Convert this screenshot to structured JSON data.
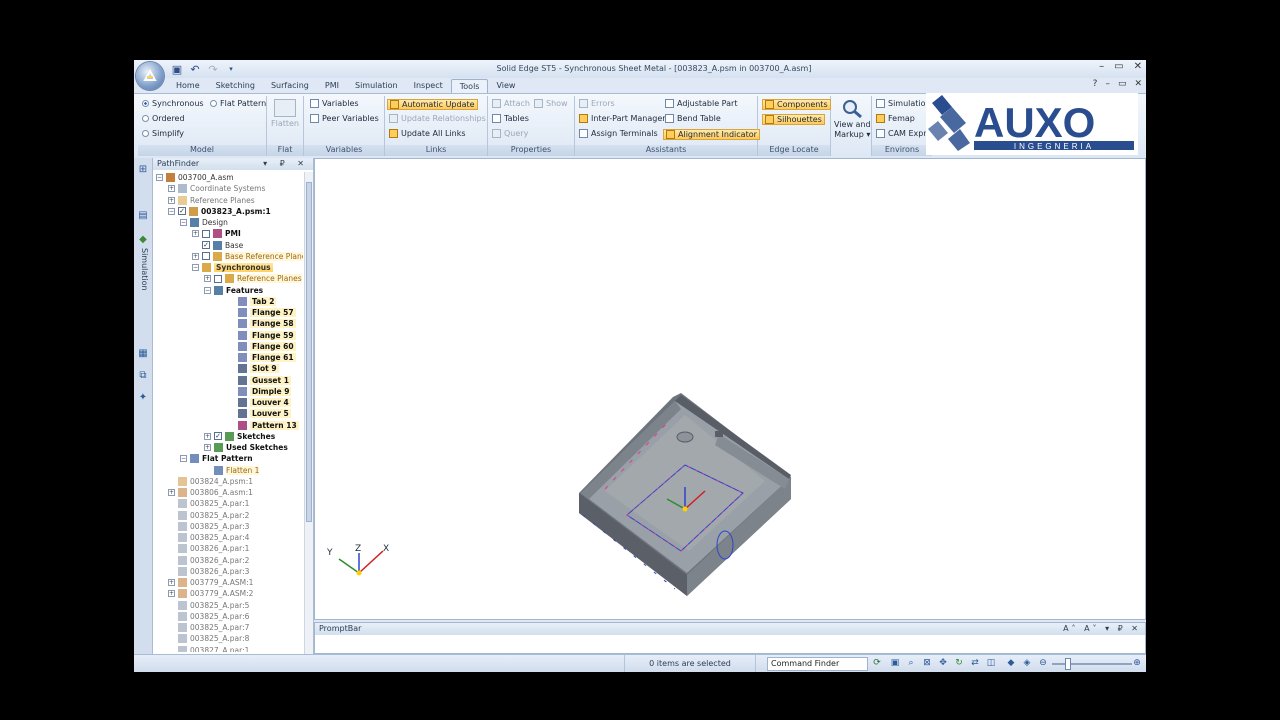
{
  "window": {
    "title": "Solid Edge ST5 - Synchronous Sheet Metal - [003823_A.psm in 003700_A.asm]",
    "controls": [
      "–",
      "▭",
      "✕"
    ],
    "sub_controls": [
      "?",
      "–",
      "▭",
      "✕"
    ]
  },
  "ribbon_tabs": [
    {
      "label": "Home"
    },
    {
      "label": "Sketching"
    },
    {
      "label": "Surfacing"
    },
    {
      "label": "PMI"
    },
    {
      "label": "Simulation"
    },
    {
      "label": "Inspect"
    },
    {
      "label": "Tools",
      "active": true
    },
    {
      "label": "View"
    }
  ],
  "groups": {
    "model": {
      "label": "Model",
      "synchronous": "Synchronous",
      "flat_pattern": "Flat Pattern",
      "ordered": "Ordered",
      "simplify": "Simplify"
    },
    "flat": {
      "label": "Flat",
      "flatten": "Flatten"
    },
    "variables": {
      "label": "Variables",
      "variables": "Variables",
      "peer_variables": "Peer Variables"
    },
    "links": {
      "label": "Links",
      "automatic_update": "Automatic Update",
      "update_relationships": "Update Relationships",
      "update_all_links": "Update All Links"
    },
    "properties": {
      "label": "Properties",
      "attach": "Attach",
      "show": "Show",
      "tables": "Tables",
      "query": "Query"
    },
    "assistants": {
      "label": "Assistants",
      "errors": "Errors",
      "adjustable_part": "Adjustable Part",
      "inter_part_manager": "Inter-Part Manager",
      "bend_table": "Bend Table",
      "assign_terminals": "Assign Terminals",
      "alignment_indicator": "Alignment Indicator"
    },
    "edge_locate": {
      "label": "Edge Locate",
      "components": "Components",
      "silhouettes": "Silhouettes"
    },
    "view_markup": {
      "line1": "View and",
      "line2": "Markup ▾"
    },
    "environs": {
      "label": "Environs",
      "simulation": "Simulatio",
      "femap": "Femap",
      "cam_express": "CAM Expr"
    }
  },
  "logo": {
    "name": "AUXO",
    "sub": "INGEGNERIA",
    "color": "#2a4d8f"
  },
  "left_strip": {
    "simulation": "Simulation"
  },
  "pathfinder": {
    "title": "PathFinder",
    "controls": "▾ ₽ ✕",
    "tree": [
      {
        "label": "003700_A.asm",
        "indent": 0,
        "exp": "−",
        "style": "",
        "icon": "asm"
      },
      {
        "label": "Coordinate Systems",
        "indent": 1,
        "exp": "+",
        "style": "gray",
        "icon": "cs"
      },
      {
        "label": "Reference Planes",
        "indent": 1,
        "exp": "+",
        "style": "gray",
        "icon": "rp"
      },
      {
        "label": "003823_A.psm:1",
        "indent": 1,
        "exp": "−",
        "style": "bold",
        "icon": "psm",
        "check": "✓"
      },
      {
        "label": "Design",
        "indent": 2,
        "exp": "−",
        "style": "",
        "icon": "design"
      },
      {
        "label": "PMI",
        "indent": 3,
        "exp": "+",
        "style": "bold",
        "icon": "pmi",
        "check": " "
      },
      {
        "label": "Base",
        "indent": 3,
        "exp": "",
        "style": "",
        "icon": "base",
        "check": "✓"
      },
      {
        "label": "Base Reference Planes",
        "indent": 3,
        "exp": "+",
        "style": "ora",
        "icon": "rp",
        "check": " "
      },
      {
        "label": "Synchronous",
        "indent": 3,
        "exp": "−",
        "style": "sel",
        "icon": "sync"
      },
      {
        "label": "Reference Planes",
        "indent": 4,
        "exp": "+",
        "style": "ora",
        "icon": "rp",
        "check": " "
      },
      {
        "label": "Features",
        "indent": 4,
        "exp": "−",
        "style": "bold",
        "icon": "feat"
      },
      {
        "label": "Tab 2",
        "indent": 6,
        "exp": "",
        "style": "hlrow bold",
        "icon": "tab"
      },
      {
        "label": "Flange 57",
        "indent": 6,
        "exp": "",
        "style": "hlrow bold",
        "icon": "flange"
      },
      {
        "label": "Flange 58",
        "indent": 6,
        "exp": "",
        "style": "hlrow bold",
        "icon": "flange"
      },
      {
        "label": "Flange 59",
        "indent": 6,
        "exp": "",
        "style": "hlrow bold",
        "icon": "flange"
      },
      {
        "label": "Flange 60",
        "indent": 6,
        "exp": "",
        "style": "hlrow bold",
        "icon": "flange"
      },
      {
        "label": "Flange 61",
        "indent": 6,
        "exp": "",
        "style": "hlrow bold",
        "icon": "flange"
      },
      {
        "label": "Slot 9",
        "indent": 6,
        "exp": "",
        "style": "hlrow bold",
        "icon": "slot"
      },
      {
        "label": "Gusset 1",
        "indent": 6,
        "exp": "",
        "style": "hlrow bold",
        "icon": "gusset"
      },
      {
        "label": "Dimple 9",
        "indent": 6,
        "exp": "",
        "style": "hlrow bold",
        "icon": "dimple"
      },
      {
        "label": "Louver 4",
        "indent": 6,
        "exp": "",
        "style": "hlrow bold",
        "icon": "louver"
      },
      {
        "label": "Louver 5",
        "indent": 6,
        "exp": "",
        "style": "hlrow bold",
        "icon": "louver"
      },
      {
        "label": "Pattern 13",
        "indent": 6,
        "exp": "",
        "style": "hlrow bold",
        "icon": "pattern"
      },
      {
        "label": "Sketches",
        "indent": 4,
        "exp": "+",
        "style": "bold",
        "icon": "sketch",
        "check": "✓"
      },
      {
        "label": "Used Sketches",
        "indent": 4,
        "exp": "+",
        "style": "bold",
        "icon": "sketch"
      },
      {
        "label": "Flat Pattern",
        "indent": 2,
        "exp": "−",
        "style": "bold",
        "icon": "flat"
      },
      {
        "label": "Flatten 1",
        "indent": 4,
        "exp": "",
        "style": "ora",
        "icon": "flat"
      },
      {
        "label": "003824_A.psm:1",
        "indent": 1,
        "exp": "",
        "style": "gray",
        "icon": "psm"
      },
      {
        "label": "003806_A.asm:1",
        "indent": 1,
        "exp": "+",
        "style": "gray",
        "icon": "asm"
      },
      {
        "label": "003825_A.par:1",
        "indent": 1,
        "exp": "",
        "style": "gray",
        "icon": "par"
      },
      {
        "label": "003825_A.par:2",
        "indent": 1,
        "exp": "",
        "style": "gray",
        "icon": "par"
      },
      {
        "label": "003825_A.par:3",
        "indent": 1,
        "exp": "",
        "style": "gray",
        "icon": "par"
      },
      {
        "label": "003825_A.par:4",
        "indent": 1,
        "exp": "",
        "style": "gray",
        "icon": "par"
      },
      {
        "label": "003826_A.par:1",
        "indent": 1,
        "exp": "",
        "style": "gray",
        "icon": "par"
      },
      {
        "label": "003826_A.par:2",
        "indent": 1,
        "exp": "",
        "style": "gray",
        "icon": "par"
      },
      {
        "label": "003826_A.par:3",
        "indent": 1,
        "exp": "",
        "style": "gray",
        "icon": "par"
      },
      {
        "label": "003779_A.ASM:1",
        "indent": 1,
        "exp": "+",
        "style": "gray",
        "icon": "asm"
      },
      {
        "label": "003779_A.ASM:2",
        "indent": 1,
        "exp": "+",
        "style": "gray",
        "icon": "asm"
      },
      {
        "label": "003825_A.par:5",
        "indent": 1,
        "exp": "",
        "style": "gray",
        "icon": "par"
      },
      {
        "label": "003825_A.par:6",
        "indent": 1,
        "exp": "",
        "style": "gray",
        "icon": "par"
      },
      {
        "label": "003825_A.par:7",
        "indent": 1,
        "exp": "",
        "style": "gray",
        "icon": "par"
      },
      {
        "label": "003825_A.par:8",
        "indent": 1,
        "exp": "",
        "style": "gray",
        "icon": "par"
      },
      {
        "label": "003827_A.par:1",
        "indent": 1,
        "exp": "",
        "style": "gray",
        "icon": "par"
      }
    ]
  },
  "viewport": {
    "triad": {
      "x": "X",
      "y": "Y",
      "z": "Z"
    }
  },
  "promptbar": {
    "title": "PromptBar",
    "controls": "A˄ A˅ ▾ ₽ ✕"
  },
  "statusbar": {
    "items_selected": "0 items are selected",
    "command_finder": "Command Finder"
  },
  "colors": {
    "accent_highlight": "#ffd05c",
    "ribbon_bg": "#dde7f4",
    "part_gray": "#8d939b",
    "sketch_magenta": "#e03a8c",
    "sketch_blue": "#2d46c8"
  }
}
